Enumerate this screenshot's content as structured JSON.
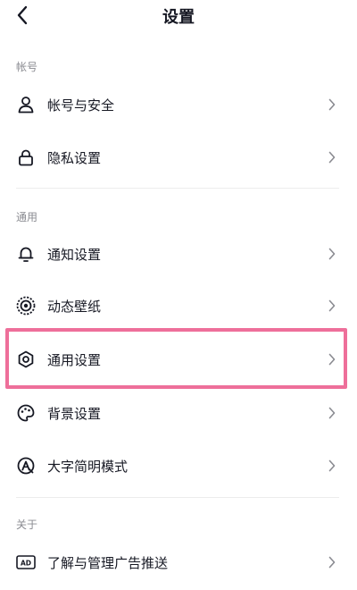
{
  "header": {
    "title": "设置"
  },
  "sections": {
    "account": {
      "title": "帐号"
    },
    "general": {
      "title": "通用"
    },
    "about": {
      "title": "关于"
    }
  },
  "items": {
    "account_security": {
      "label": "帐号与安全",
      "icon": "user-icon"
    },
    "privacy": {
      "label": "隐私设置",
      "icon": "lock-icon"
    },
    "notification": {
      "label": "通知设置",
      "icon": "bell-icon"
    },
    "live_wallpaper": {
      "label": "动态壁纸",
      "icon": "wallpaper-icon"
    },
    "general_settings": {
      "label": "通用设置",
      "icon": "gear-icon"
    },
    "background": {
      "label": "背景设置",
      "icon": "palette-icon"
    },
    "big_font": {
      "label": "大字简明模式",
      "icon": "font-a-icon"
    },
    "ad_push": {
      "label": "了解与管理广告推送",
      "icon": "ad-icon"
    }
  },
  "colors": {
    "highlight": "#ee6f9a",
    "section_title": "#8a8b91",
    "text": "#161823",
    "chevron": "#8a8b91"
  }
}
